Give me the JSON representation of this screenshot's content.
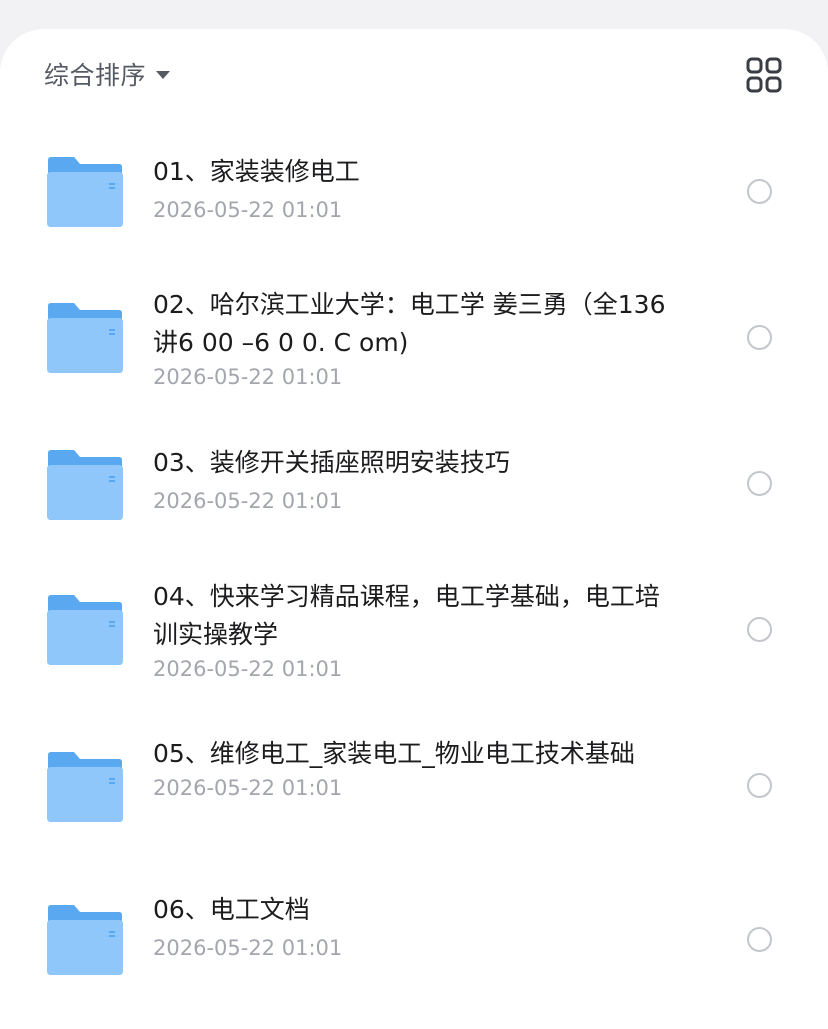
{
  "toolbar": {
    "sort_label": "综合排序",
    "caret_icon": "caret-down-icon",
    "view_icon": "grid-view-icon"
  },
  "colors": {
    "folder_back": "#5aa8f0",
    "folder_front": "#8fc7fb",
    "text": "#1c1c1e",
    "subtext": "#a3a6ad"
  },
  "files": [
    {
      "name": "01、家装装修电工",
      "date": "2026-05-22 01:01",
      "icon": "folder-icon"
    },
    {
      "name": "02、哈尔滨工业大学：电工学 姜三勇（全136讲6 00 –6 0 0. C om)",
      "date": "2026-05-22 01:01",
      "icon": "folder-icon"
    },
    {
      "name": "03、装修开关插座照明安装技巧",
      "date": "2026-05-22 01:01",
      "icon": "folder-icon"
    },
    {
      "name": "04、快来学习精品课程，电工学基础，电工培训实操教学",
      "date": "2026-05-22 01:01",
      "icon": "folder-icon"
    },
    {
      "name": "05、维修电工_家装电工_物业电工技术基础",
      "date": "2026-05-22 01:01",
      "icon": "folder-icon"
    },
    {
      "name": "06、电工文档",
      "date": "2026-05-22 01:01",
      "icon": "folder-icon"
    }
  ]
}
